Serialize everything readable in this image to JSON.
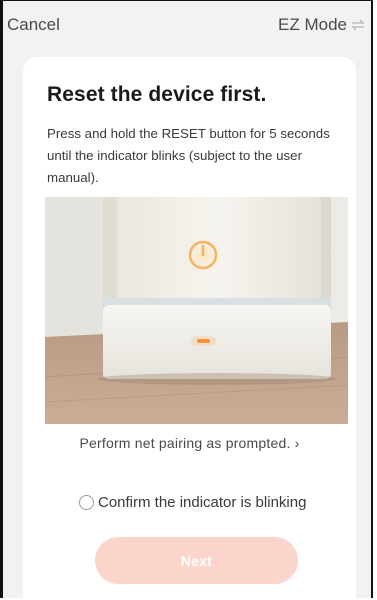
{
  "header": {
    "cancel_label": "Cancel",
    "mode_label": "EZ Mode",
    "mode_icon": "swap-icon"
  },
  "card": {
    "title": "Reset the device first.",
    "description": "Press and hold the RESET button for 5 seconds until the indicator blinks (subject to the user manual).",
    "pairing_link": "Perform net pairing as prompted. ›",
    "confirm_label": "Confirm the indicator is blinking",
    "confirm_checked": false,
    "next_label": "Next"
  },
  "colors": {
    "accent_disabled": "#fbd5cb",
    "indicator": "#f08a2c",
    "background": "#f4f2f1"
  }
}
